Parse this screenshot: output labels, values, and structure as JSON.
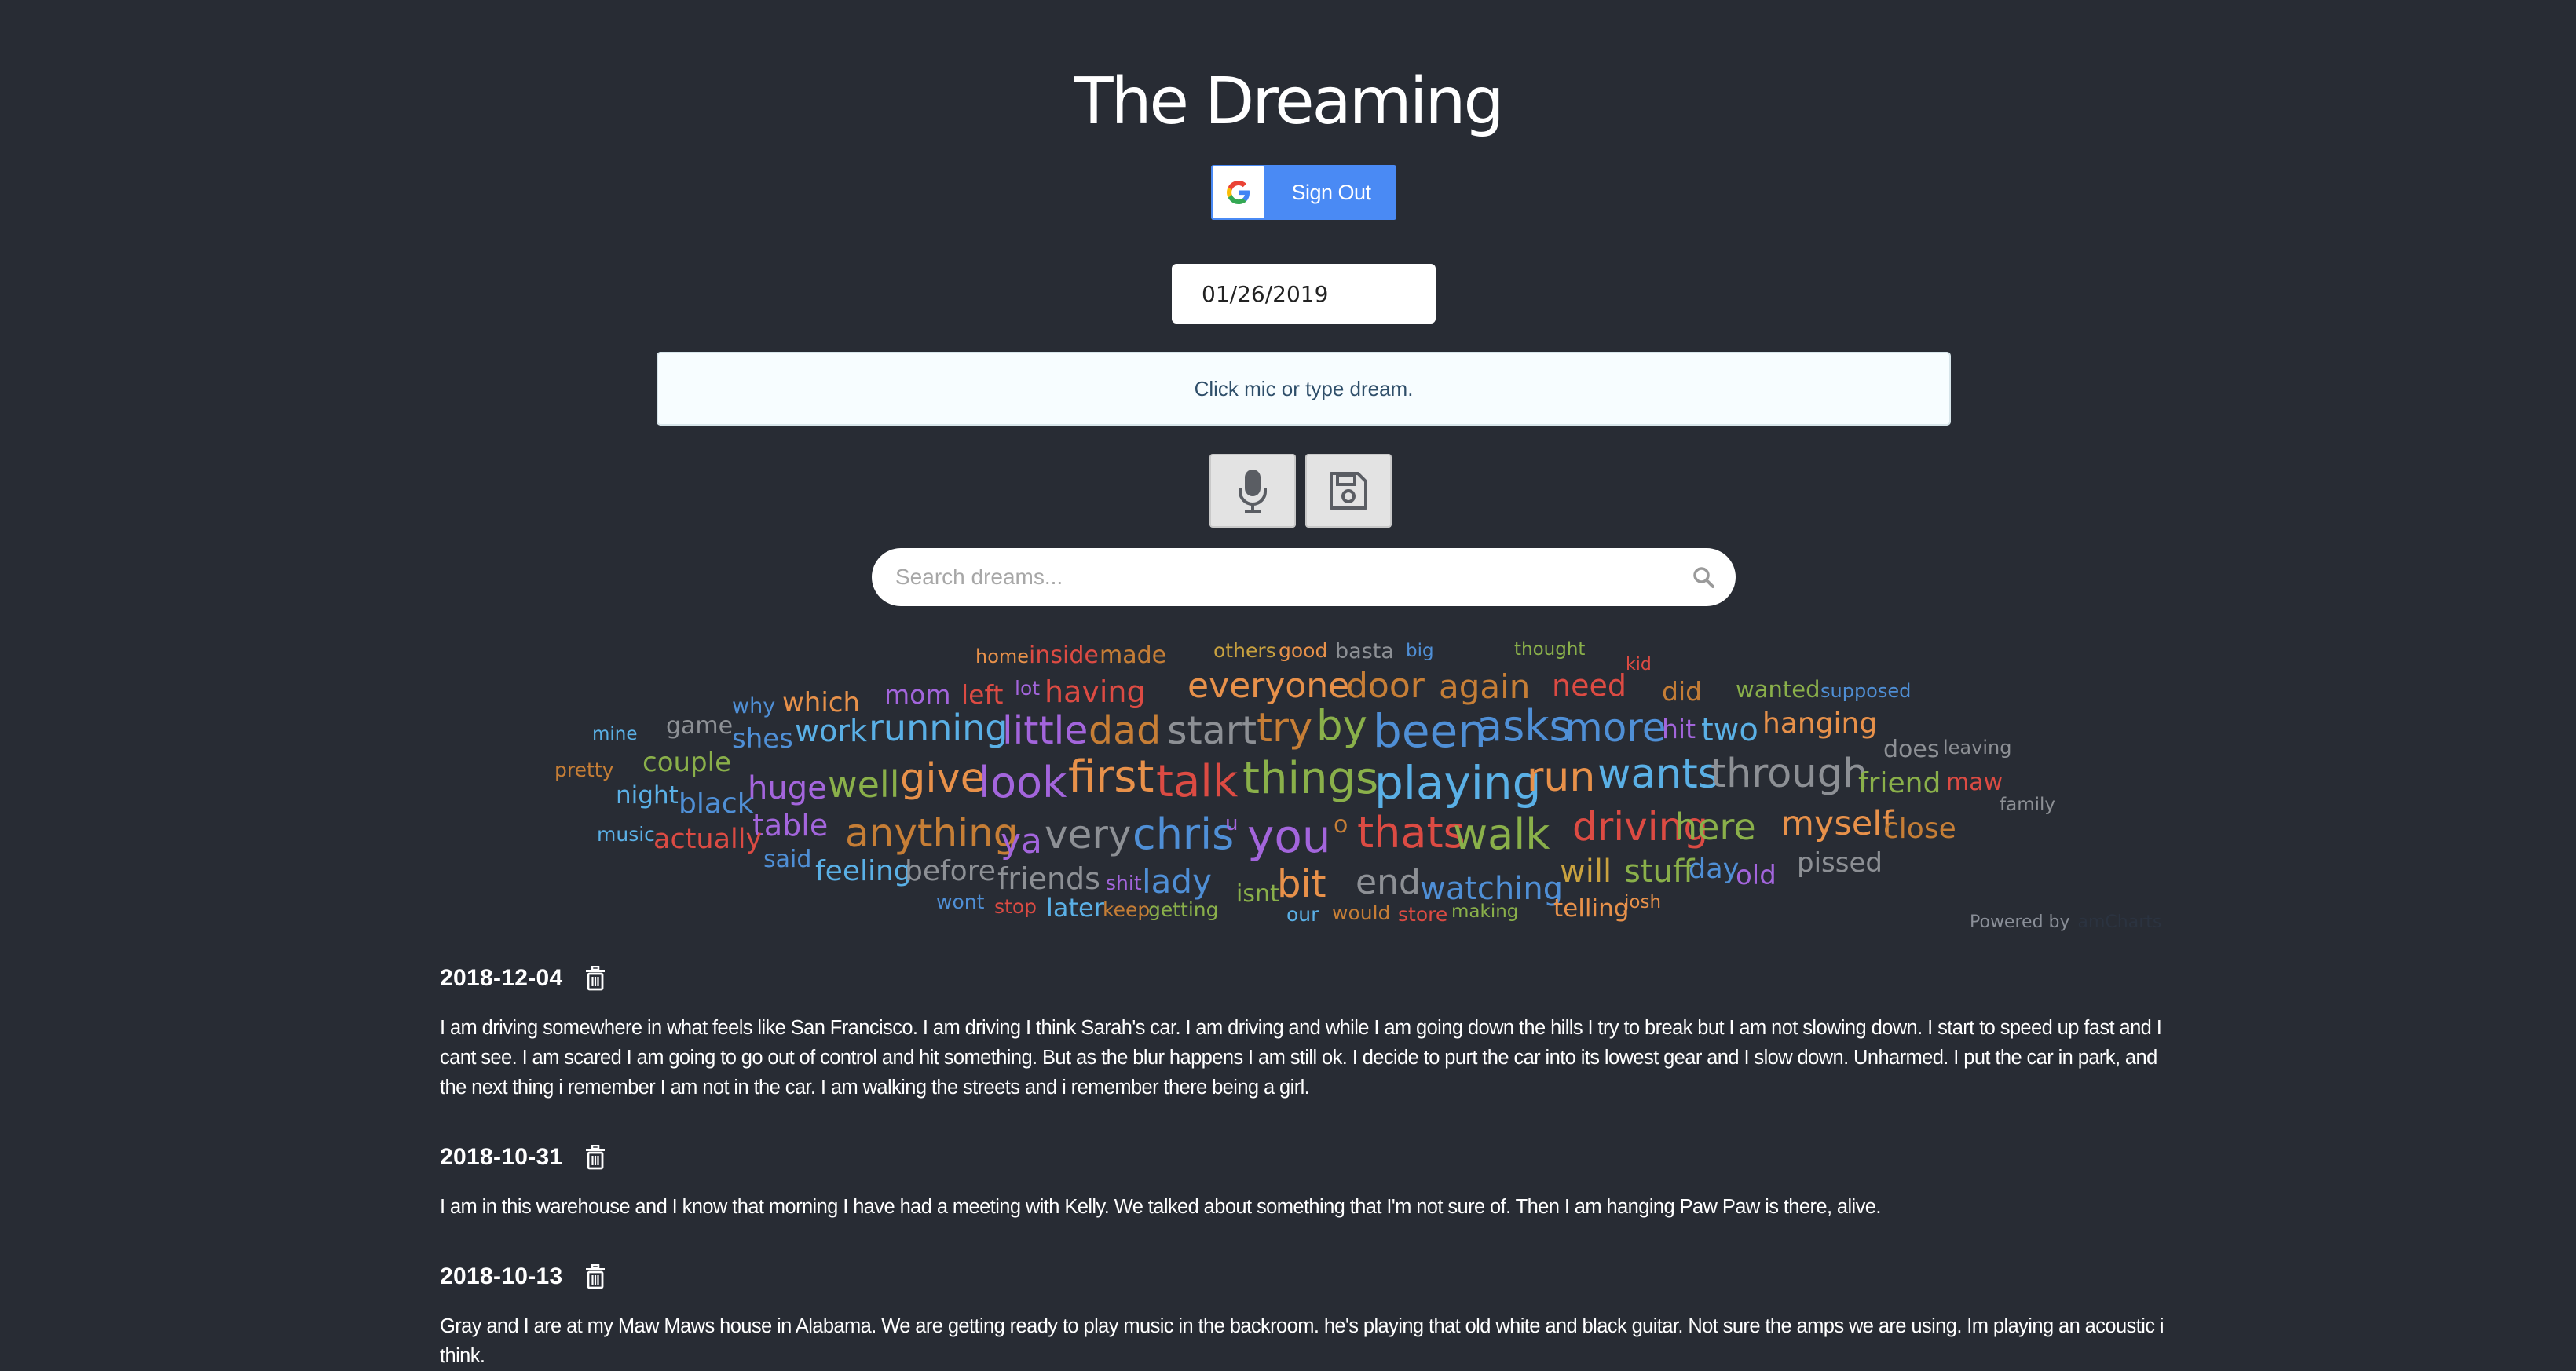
{
  "app": {
    "title": "The Dreaming"
  },
  "auth": {
    "button_label": "Sign Out",
    "icon": "google-g-icon"
  },
  "date_input": {
    "value": "01/26/2019"
  },
  "dream_input": {
    "prompt": "Click mic or type dream."
  },
  "controls": {
    "mic_icon": "microphone-icon",
    "save_icon": "floppy-disk-icon"
  },
  "search": {
    "placeholder": "Search dreams...",
    "icon": "search-icon"
  },
  "word_cloud": {
    "powered_by": "Powered by",
    "brand": "amCharts",
    "words": [
      "home",
      "inside",
      "made",
      "others",
      "good",
      "basta",
      "big",
      "thought",
      "kid",
      "mom",
      "left",
      "lot",
      "having",
      "everyone",
      "door",
      "again",
      "need",
      "did",
      "wanted",
      "supposed",
      "why",
      "which",
      "mine",
      "game",
      "shes",
      "work",
      "running",
      "little",
      "dad",
      "start",
      "try",
      "by",
      "been",
      "asks",
      "more",
      "hit",
      "two",
      "hanging",
      "does",
      "leaving",
      "pretty",
      "couple",
      "huge",
      "well",
      "give",
      "look",
      "first",
      "talk",
      "things",
      "playing",
      "run",
      "wants",
      "through",
      "friend",
      "maw",
      "night",
      "black",
      "table",
      "anything",
      "ya",
      "very",
      "chris",
      "u",
      "you",
      "o",
      "thats",
      "walk",
      "driving",
      "here",
      "myself",
      "close",
      "family",
      "music",
      "actually",
      "said",
      "feeling",
      "before",
      "friends",
      "shit",
      "lady",
      "bit",
      "end",
      "watching",
      "will",
      "stuff",
      "day",
      "old",
      "pissed",
      "wont",
      "stop",
      "later",
      "keep",
      "getting",
      "isnt",
      "our",
      "would",
      "store",
      "making",
      "telling",
      "josh"
    ]
  },
  "entries": [
    {
      "date": "2018-12-04",
      "text": "I am driving somewhere in what feels like San Francisco. I am driving I think Sarah's car. I am driving and while I am going down the hills I try to break but I am not slowing down. I start to speed up fast and I cant see. I am scared I am going to go out of control and hit something. But as the blur happens I am still ok. I decide to purt the car into its lowest gear and I slow down. Unharmed. I put the car in park, and the next thing i remember I am not in the car. I am walking the streets and i remember there being a girl."
    },
    {
      "date": "2018-10-31",
      "text": "I am in this warehouse and I know that morning I have had a meeting with Kelly. We talked about something that I'm not sure of. Then I am hanging Paw Paw is there, alive."
    },
    {
      "date": "2018-10-13",
      "text": "Gray and I are at my Maw Maws house in Alabama. We are getting ready to play music in the backroom. he's playing that old white and black guitar. Not sure the amps we are using. Im playing an acoustic i think."
    }
  ]
}
